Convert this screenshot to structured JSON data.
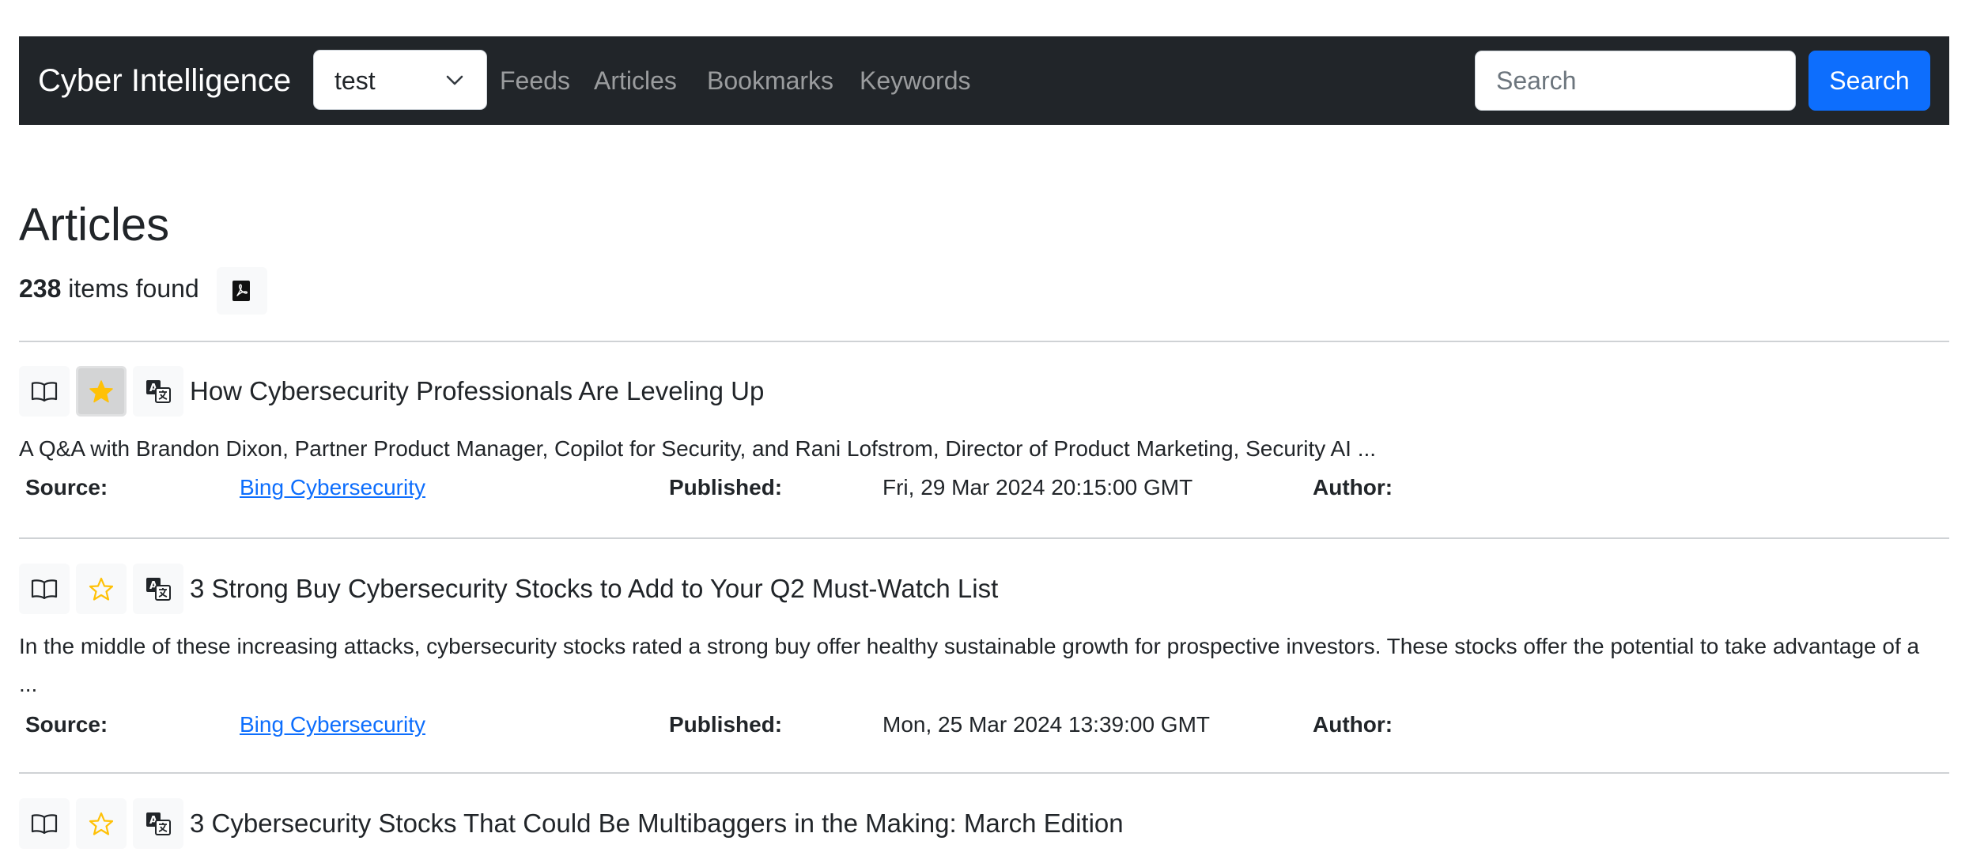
{
  "navbar": {
    "brand": "Cyber Intelligence",
    "workspace_select": {
      "value": "test"
    },
    "links": [
      "Feeds",
      "Articles",
      "Bookmarks",
      "Keywords"
    ],
    "search": {
      "placeholder": "Search",
      "button_label": "Search"
    }
  },
  "page": {
    "title": "Articles",
    "count": "238",
    "count_suffix": "items found"
  },
  "labels": {
    "source": "Source:",
    "published": "Published:",
    "author": "Author:"
  },
  "articles": [
    {
      "title": "How Cybersecurity Professionals Are Leveling Up",
      "summary": "A Q&A with Brandon Dixon, Partner Product Manager, Copilot for Security, and Rani Lofstrom, Director of Product Marketing, Security AI ...",
      "source": "Bing Cybersecurity",
      "published": "Fri, 29 Mar 2024 20:15:00 GMT",
      "author": "",
      "bookmarked": true
    },
    {
      "title": "3 Strong Buy Cybersecurity Stocks to Add to Your Q2 Must-Watch List",
      "summary": "In the middle of these increasing attacks, cybersecurity stocks rated a strong buy offer healthy sustainable growth for prospective investors. These stocks offer the potential to take advantage of a ...",
      "source": "Bing Cybersecurity",
      "published": "Mon, 25 Mar 2024 13:39:00 GMT",
      "author": "",
      "bookmarked": false
    },
    {
      "title": "3 Cybersecurity Stocks That Could Be Multibaggers in the Making: March Edition",
      "bookmarked": false
    }
  ],
  "colors": {
    "navbar_bg": "#212529",
    "primary": "#0d6efd",
    "star": "#ffc107"
  },
  "icons": {
    "read": "book-icon",
    "bookmark": "star-icon",
    "translate": "translate-icon",
    "export": "pdf-icon"
  }
}
